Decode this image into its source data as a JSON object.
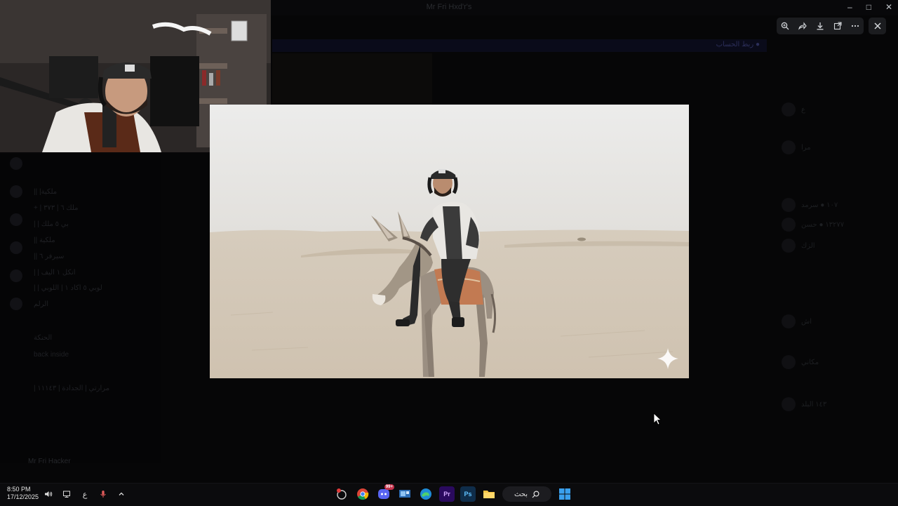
{
  "background_app": {
    "window_title": "Mr Fri Hxd'r's",
    "banner_text": "ربط الحساب ●",
    "channels": [
      "|| |ملكية",
      "+ | ملك ٦ | ٣٧٣",
      "| | بي ٥ ملك",
      "|| ملكية",
      "|| سيرفر ٦",
      "| | انكل ١ اليف",
      "| | لوبي ٥ اكاد ١ | اللوبي",
      "الرلم",
      "الحنكة",
      "back inside",
      "| مرارتي | الجدادة | ١١١٤٣"
    ],
    "user_name": "Mr Fri Hacker",
    "members": [
      "ع",
      "مرا",
      "١٠٧ ● سرمد",
      "١٣٢٧٧ ● حسن",
      "الزك",
      "اش",
      "مكاني",
      "١٤٣ البلد"
    ]
  },
  "viewer": {
    "toolbar": {
      "zoom_icon": "zoom-in-icon",
      "share_icon": "share-icon",
      "download_icon": "download-icon",
      "open_icon": "open-external-icon",
      "more_icon": "more-icon",
      "close_icon": "close-icon"
    }
  },
  "taskbar": {
    "time": "8:50 PM",
    "date": "17/12/2025",
    "input_language": "ع",
    "search_label": "بحث",
    "apps": [
      {
        "name": "Chrome",
        "icon": "chrome-icon"
      },
      {
        "name": "Discord",
        "icon": "discord-icon",
        "badge": "99+"
      },
      {
        "name": "Task View",
        "icon": "task-view-icon"
      },
      {
        "name": "Edge",
        "icon": "edge-icon"
      },
      {
        "name": "Premiere Pro",
        "icon": "premiere-icon",
        "label": "Pr"
      },
      {
        "name": "Photoshop",
        "icon": "photoshop-icon",
        "label": "Ps"
      },
      {
        "name": "File Explorer",
        "icon": "folder-icon"
      }
    ]
  },
  "colors": {
    "premiere": "#2a0a5e",
    "photoshop": "#0f2d4a",
    "windows": "#3aa0ee"
  }
}
